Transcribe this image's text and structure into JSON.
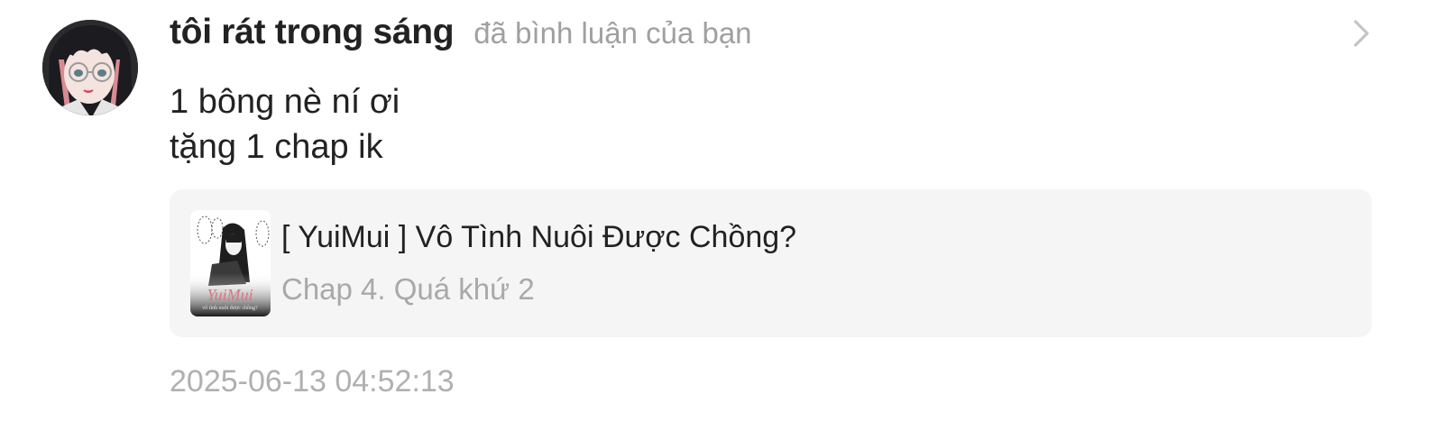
{
  "notification": {
    "username": "tôi rát trong sáng",
    "action": "đã bình luận của bạn",
    "comment_lines": [
      "1 bông nè ní ơi",
      "tặng 1 chap ik"
    ],
    "story": {
      "title": "[ YuiMui ] Vô Tình Nuôi Được Chồng?",
      "chapter": "Chap 4. Quá khứ 2",
      "cover_text": "YuiMui",
      "cover_subtext": "vô tình nuôi được chồng?"
    },
    "timestamp": "2025-06-13 04:52:13"
  },
  "icons": {
    "avatar": "user-avatar-icon",
    "chevron": "chevron-right-icon",
    "cover": "story-cover-image"
  },
  "colors": {
    "text_primary": "#222222",
    "text_secondary": "#a0a0a0",
    "card_background": "#f5f5f6",
    "cover_accent": "#d9767f"
  }
}
